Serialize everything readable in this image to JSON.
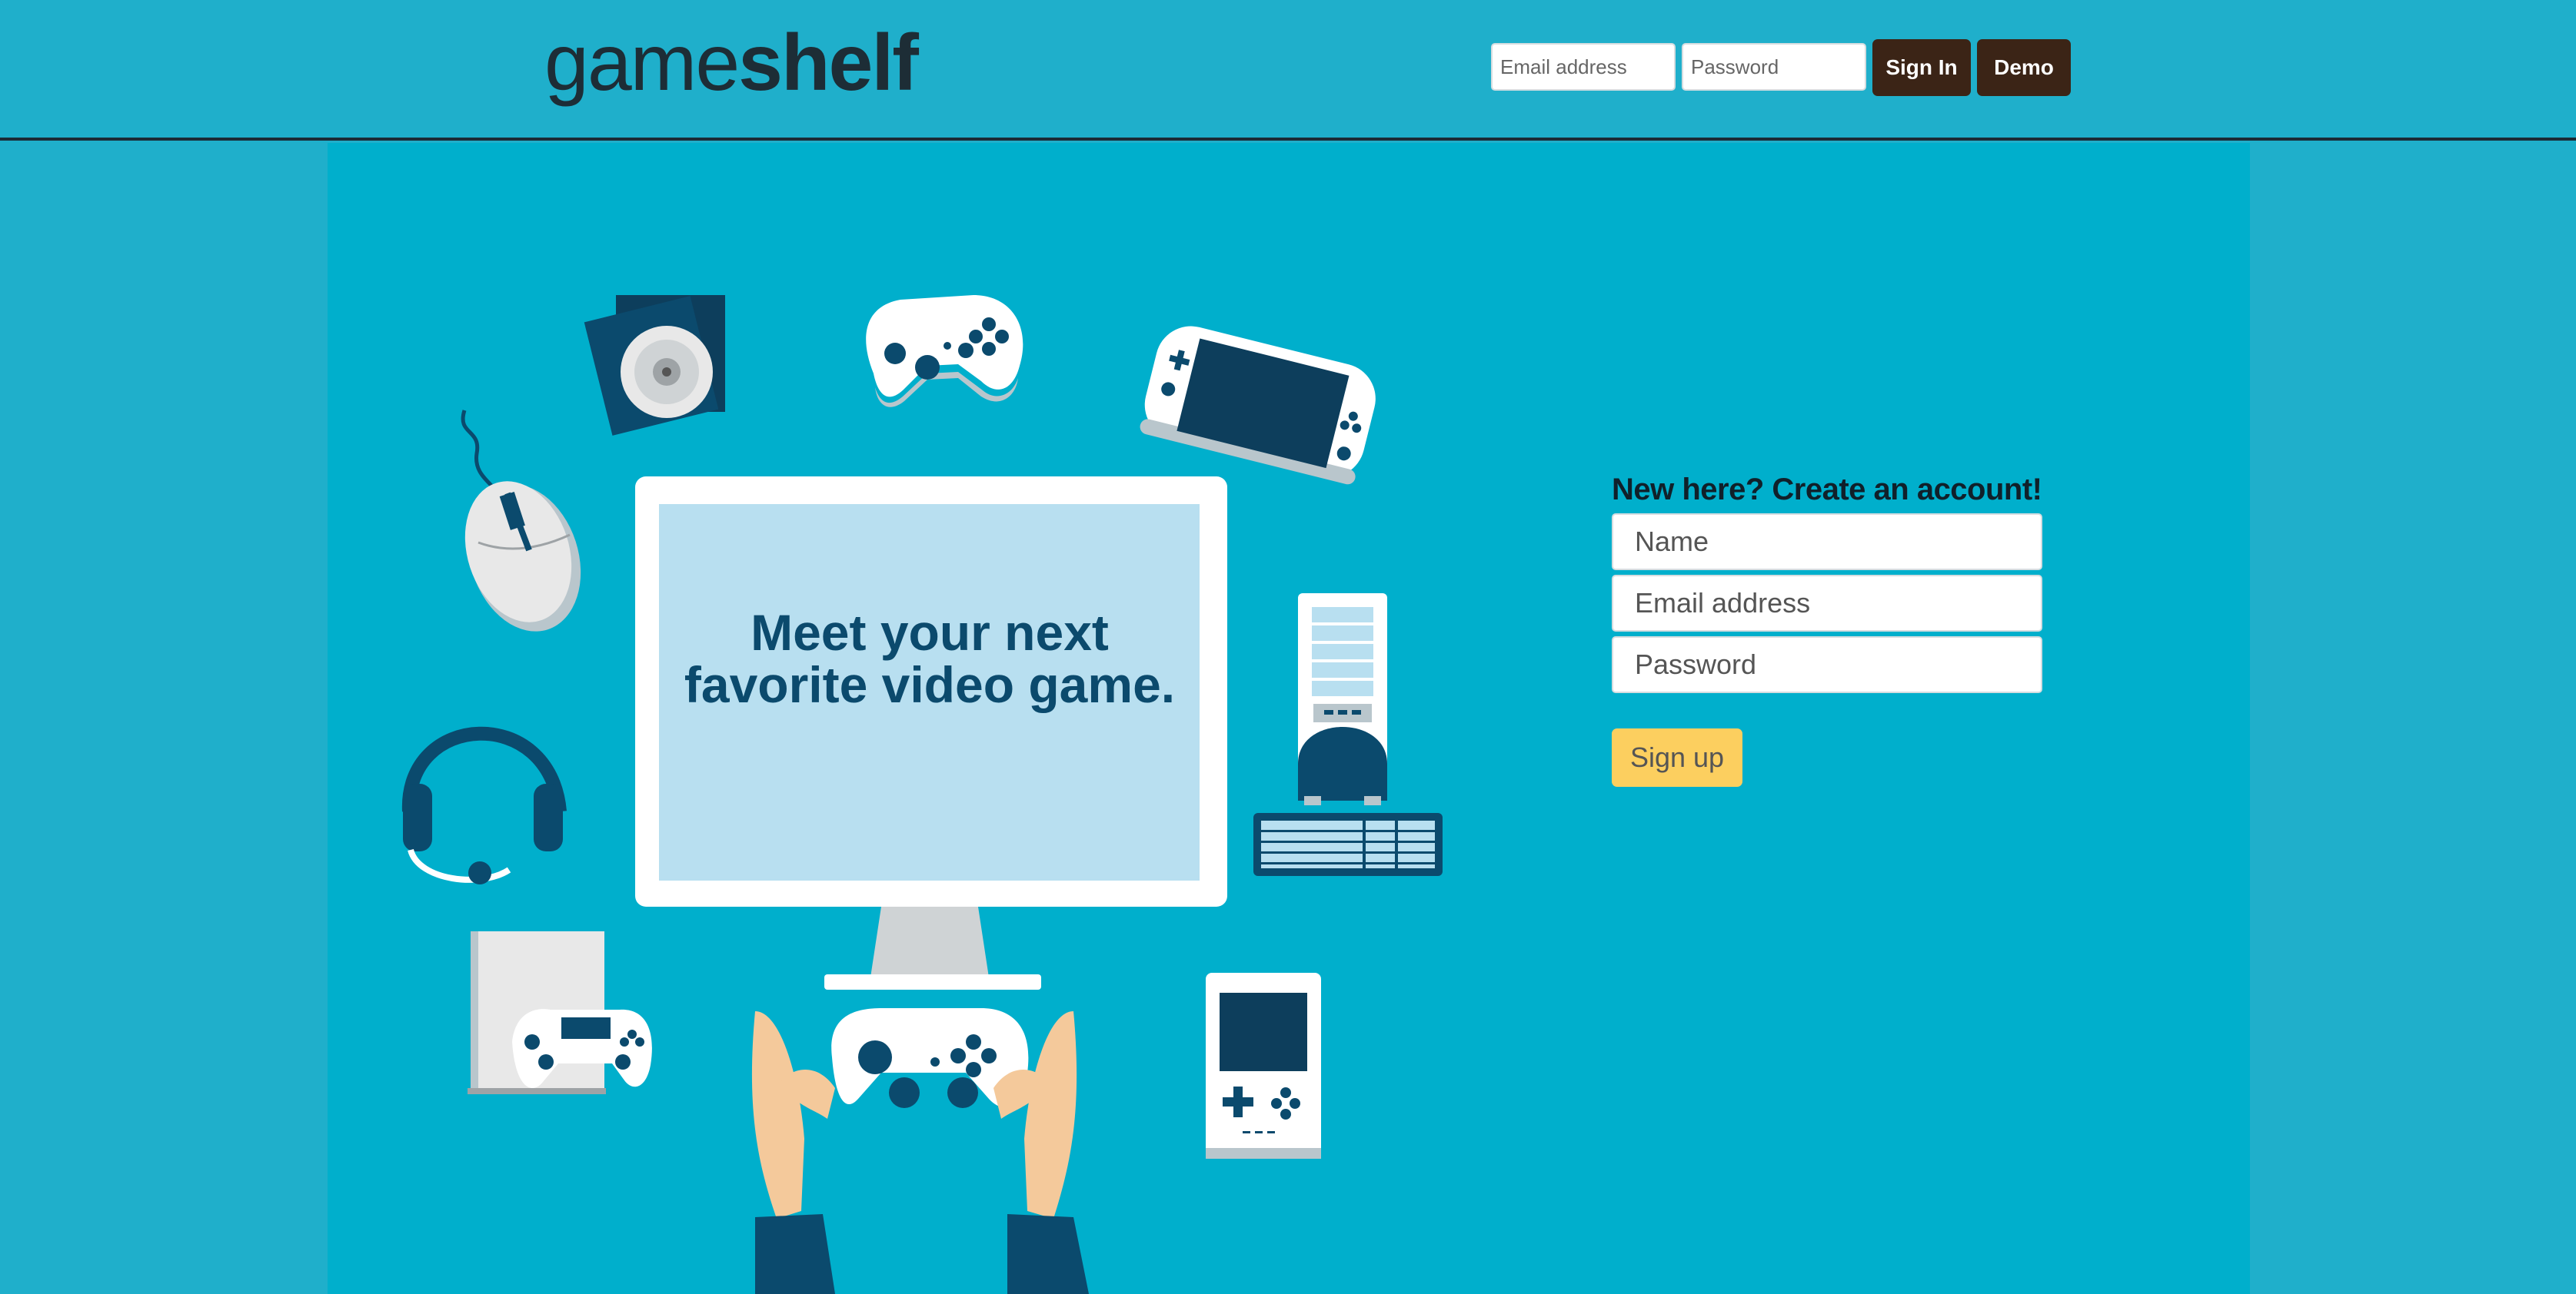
{
  "header": {
    "logo_light": "game",
    "logo_bold": "shelf",
    "email_placeholder": "Email address",
    "password_placeholder": "Password",
    "signin_label": "Sign In",
    "demo_label": "Demo"
  },
  "hero": {
    "line1": "Meet your next",
    "line2": "favorite video game."
  },
  "signup": {
    "heading": "New here? Create an account!",
    "name_placeholder": "Name",
    "email_placeholder": "Email address",
    "password_placeholder": "Password",
    "button_label": "Sign up"
  },
  "colors": {
    "header_bg": "#1fafcb",
    "main_bg": "#00afcc",
    "dark_button": "#3b2416",
    "signup_button": "#fccf5f",
    "icon_dark": "#0b4a6d",
    "icon_white": "#ffffff"
  },
  "icons": [
    "cd-icon",
    "gamepad-icon",
    "handheld-console-icon",
    "mouse-icon",
    "monitor-icon",
    "pc-tower-icon",
    "keyboard-icon",
    "headset-icon",
    "console-icon",
    "gameboy-icon",
    "hands-controller-icon"
  ]
}
